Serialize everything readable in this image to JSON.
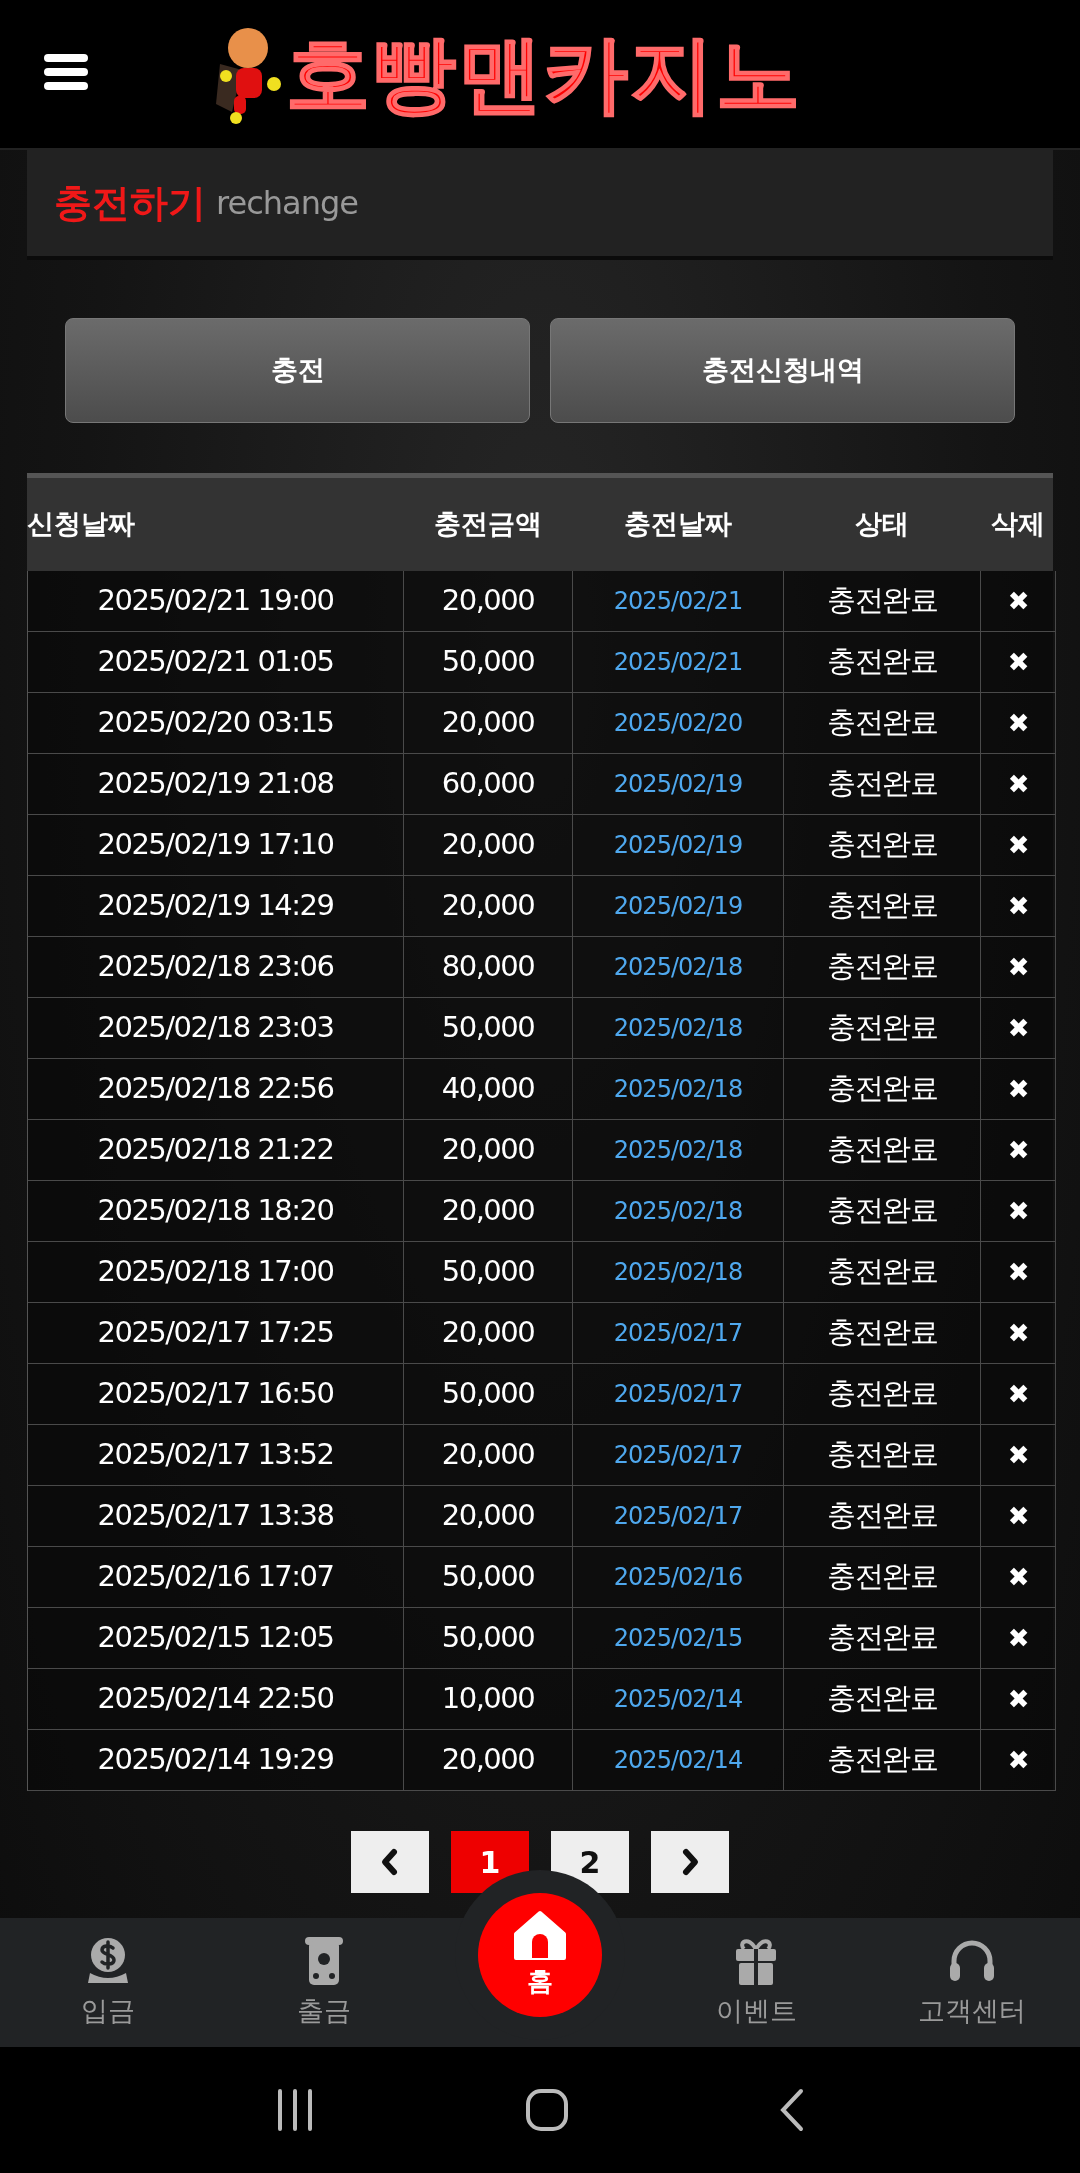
{
  "header": {
    "logo_text": "호빵맨카지노"
  },
  "section": {
    "title": "충전하기",
    "subtitle": "rechange"
  },
  "buttons": [
    {
      "label": "충전"
    },
    {
      "label": "충전신청내역"
    }
  ],
  "table": {
    "columns": [
      "신청날짜",
      "충전금액",
      "충전날짜",
      "상태",
      "삭제"
    ],
    "rows": [
      {
        "requested": "2025/02/21 19:00",
        "amount": "20,000",
        "charged_date": "2025/02/21",
        "status": "충전완료",
        "delete": "✖"
      },
      {
        "requested": "2025/02/21 01:05",
        "amount": "50,000",
        "charged_date": "2025/02/21",
        "status": "충전완료",
        "delete": "✖"
      },
      {
        "requested": "2025/02/20 03:15",
        "amount": "20,000",
        "charged_date": "2025/02/20",
        "status": "충전완료",
        "delete": "✖"
      },
      {
        "requested": "2025/02/19 21:08",
        "amount": "60,000",
        "charged_date": "2025/02/19",
        "status": "충전완료",
        "delete": "✖"
      },
      {
        "requested": "2025/02/19 17:10",
        "amount": "20,000",
        "charged_date": "2025/02/19",
        "status": "충전완료",
        "delete": "✖"
      },
      {
        "requested": "2025/02/19 14:29",
        "amount": "20,000",
        "charged_date": "2025/02/19",
        "status": "충전완료",
        "delete": "✖"
      },
      {
        "requested": "2025/02/18 23:06",
        "amount": "80,000",
        "charged_date": "2025/02/18",
        "status": "충전완료",
        "delete": "✖"
      },
      {
        "requested": "2025/02/18 23:03",
        "amount": "50,000",
        "charged_date": "2025/02/18",
        "status": "충전완료",
        "delete": "✖"
      },
      {
        "requested": "2025/02/18 22:56",
        "amount": "40,000",
        "charged_date": "2025/02/18",
        "status": "충전완료",
        "delete": "✖"
      },
      {
        "requested": "2025/02/18 21:22",
        "amount": "20,000",
        "charged_date": "2025/02/18",
        "status": "충전완료",
        "delete": "✖"
      },
      {
        "requested": "2025/02/18 18:20",
        "amount": "20,000",
        "charged_date": "2025/02/18",
        "status": "충전완료",
        "delete": "✖"
      },
      {
        "requested": "2025/02/18 17:00",
        "amount": "50,000",
        "charged_date": "2025/02/18",
        "status": "충전완료",
        "delete": "✖"
      },
      {
        "requested": "2025/02/17 17:25",
        "amount": "20,000",
        "charged_date": "2025/02/17",
        "status": "충전완료",
        "delete": "✖"
      },
      {
        "requested": "2025/02/17 16:50",
        "amount": "50,000",
        "charged_date": "2025/02/17",
        "status": "충전완료",
        "delete": "✖"
      },
      {
        "requested": "2025/02/17 13:52",
        "amount": "20,000",
        "charged_date": "2025/02/17",
        "status": "충전완료",
        "delete": "✖"
      },
      {
        "requested": "2025/02/17 13:38",
        "amount": "20,000",
        "charged_date": "2025/02/17",
        "status": "충전완료",
        "delete": "✖"
      },
      {
        "requested": "2025/02/16 17:07",
        "amount": "50,000",
        "charged_date": "2025/02/16",
        "status": "충전완료",
        "delete": "✖"
      },
      {
        "requested": "2025/02/15 12:05",
        "amount": "50,000",
        "charged_date": "2025/02/15",
        "status": "충전완료",
        "delete": "✖"
      },
      {
        "requested": "2025/02/14 22:50",
        "amount": "10,000",
        "charged_date": "2025/02/14",
        "status": "충전완료",
        "delete": "✖"
      },
      {
        "requested": "2025/02/14 19:29",
        "amount": "20,000",
        "charged_date": "2025/02/14",
        "status": "충전완료",
        "delete": "✖"
      }
    ]
  },
  "pagination": {
    "pages": [
      {
        "label": "1",
        "selected": true
      },
      {
        "label": "2",
        "selected": false
      }
    ]
  },
  "bottom_nav": [
    {
      "label": "입금",
      "selected": false
    },
    {
      "label": "출금",
      "selected": false
    },
    {
      "label": "홈",
      "selected": true
    },
    {
      "label": "이벤트",
      "selected": false
    },
    {
      "label": "고객센터",
      "selected": false
    }
  ]
}
